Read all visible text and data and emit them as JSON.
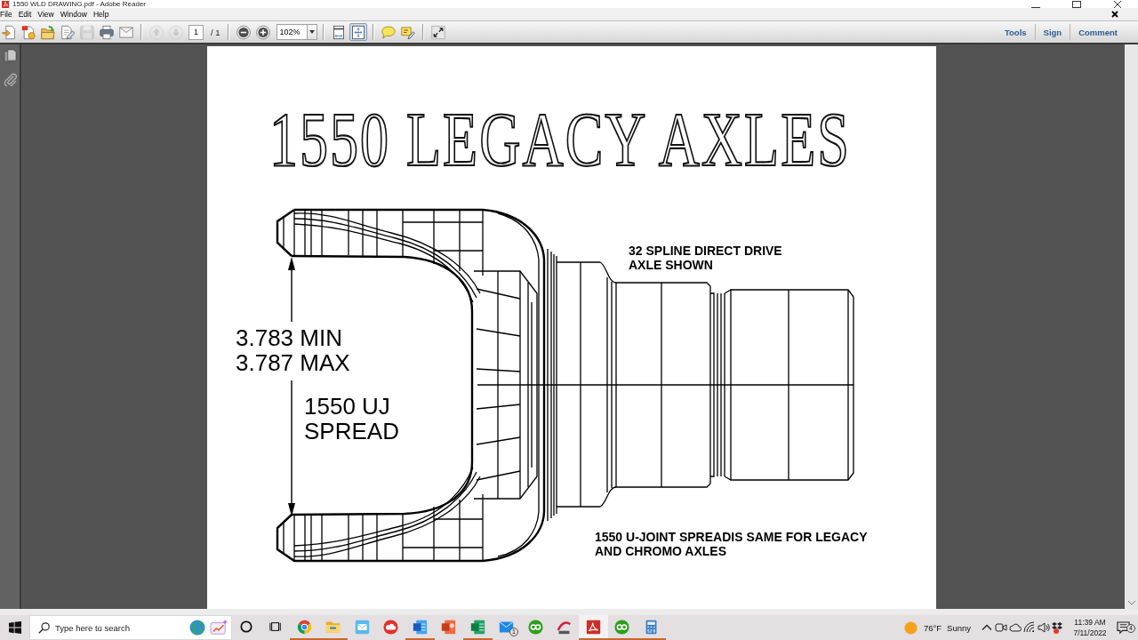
{
  "window": {
    "title": "1550 WLD DRAWING.pdf - Adobe Reader"
  },
  "menu_bar": [
    "File",
    "Edit",
    "View",
    "Window",
    "Help"
  ],
  "toolbar": {
    "file_buttons": [
      {
        "kind": "create",
        "disabled": false
      },
      {
        "kind": "combine",
        "disabled": false
      },
      {
        "kind": "open",
        "disabled": false
      },
      {
        "kind": "edit",
        "disabled": false
      },
      {
        "kind": "save",
        "disabled": true
      },
      {
        "kind": "print",
        "disabled": false
      },
      {
        "kind": "email",
        "disabled": false
      }
    ],
    "page_buttons": [
      {
        "kind": "previous",
        "disabled": true
      },
      {
        "kind": "next",
        "disabled": true
      }
    ],
    "page_field": {
      "value": "1"
    },
    "page_total": "/ 1",
    "zoom_buttons": [
      {
        "kind": "zoom_out",
        "disabled": false
      },
      {
        "kind": "zoom_in",
        "disabled": false
      }
    ],
    "zoom_field": {
      "value": "102%"
    },
    "fit_buttons": [
      {
        "kind": "fit_width",
        "selected": false
      },
      {
        "kind": "fit_page",
        "selected": true
      }
    ],
    "comment_buttons": [
      {
        "kind": "note",
        "disabled": false
      },
      {
        "kind": "highlight",
        "disabled": false
      }
    ],
    "view_buttons": [
      {
        "kind": "full_screen",
        "disabled": false
      }
    ],
    "panel_buttons": [
      "Tools",
      "Sign",
      "Comment"
    ]
  },
  "navigation_pane": [
    {
      "kind": "pages"
    },
    {
      "kind": "attachments"
    }
  ],
  "document": {
    "title": "1550 LEGACY AXLES",
    "callouts": [
      {
        "kind": "note",
        "lines": [
          "32 SPLINE DIRECT DRIVE",
          "AXLE SHOWN"
        ]
      },
      {
        "kind": "dimension",
        "lines": [
          "3.783 MIN",
          "3.787 MAX"
        ]
      },
      {
        "kind": "dimension",
        "lines": [
          "1550 UJ",
          "SPREAD"
        ]
      },
      {
        "kind": "note",
        "lines": [
          "1550 U-JOINT SPREADIS SAME FOR LEGACY",
          "AND CHROMO AXLES"
        ]
      }
    ]
  },
  "taskbar": {
    "search": {
      "placeholder": "Type here to search"
    },
    "apps": [
      {
        "kind": "browser",
        "running": true,
        "selected": false
      },
      {
        "kind": "files",
        "running": true,
        "selected": false
      },
      {
        "kind": "mail_app",
        "running": false,
        "selected": false
      },
      {
        "kind": "cloud",
        "running": false,
        "selected": false
      },
      {
        "kind": "word",
        "running": true,
        "selected": false
      },
      {
        "kind": "slides",
        "running": false,
        "selected": false
      },
      {
        "kind": "sheets",
        "running": true,
        "selected": false
      },
      {
        "kind": "mail",
        "running": false,
        "selected": false,
        "badge": "1"
      },
      {
        "kind": "books",
        "running": false,
        "selected": false
      },
      {
        "kind": "design",
        "running": false,
        "selected": false
      },
      {
        "kind": "pdf",
        "running": true,
        "selected": true
      },
      {
        "kind": "books",
        "running": true,
        "selected": false
      },
      {
        "kind": "calculator",
        "running": true,
        "selected": false
      }
    ],
    "weather": {
      "temperature": "76°F",
      "condition": "Sunny"
    },
    "clock": {
      "time": "11:39 AM",
      "date": "7/11/2022"
    },
    "notifications": {
      "badge": "4"
    }
  }
}
